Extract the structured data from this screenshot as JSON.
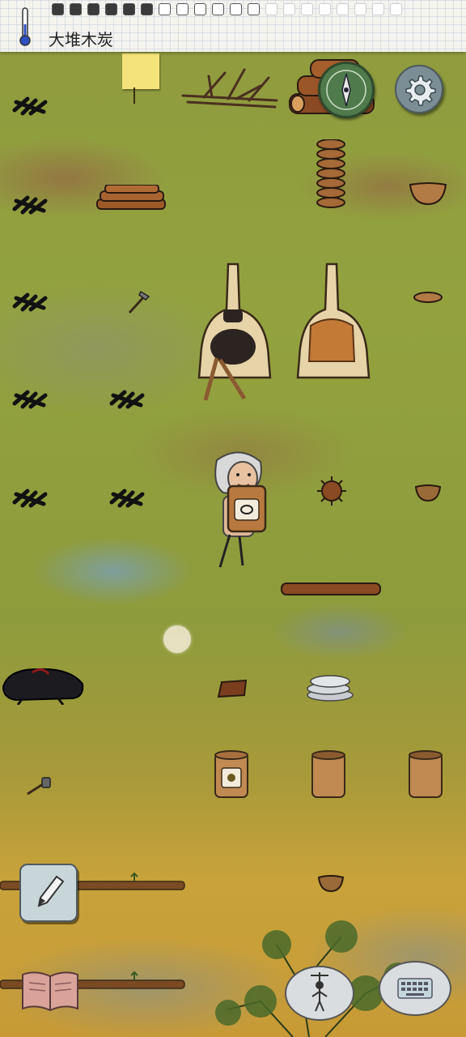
{
  "hud": {
    "held_object_label": "大堆木炭",
    "hunger": {
      "filled": 6,
      "total": 20
    }
  },
  "icons": {
    "thermometer": "thermometer-icon",
    "compass": "compass-icon",
    "settings": "gear-icon",
    "pencil": "pencil-icon",
    "book": "book-icon",
    "emote": "puppet-icon",
    "keyboard": "keyboard-icon"
  },
  "colors": {
    "grass": "#8f9a3e",
    "dry_grass": "#c9a23a",
    "note": "#f4e27a",
    "compass": "#4f7a4c",
    "thermometer_bulb": "#2d4fbf"
  }
}
